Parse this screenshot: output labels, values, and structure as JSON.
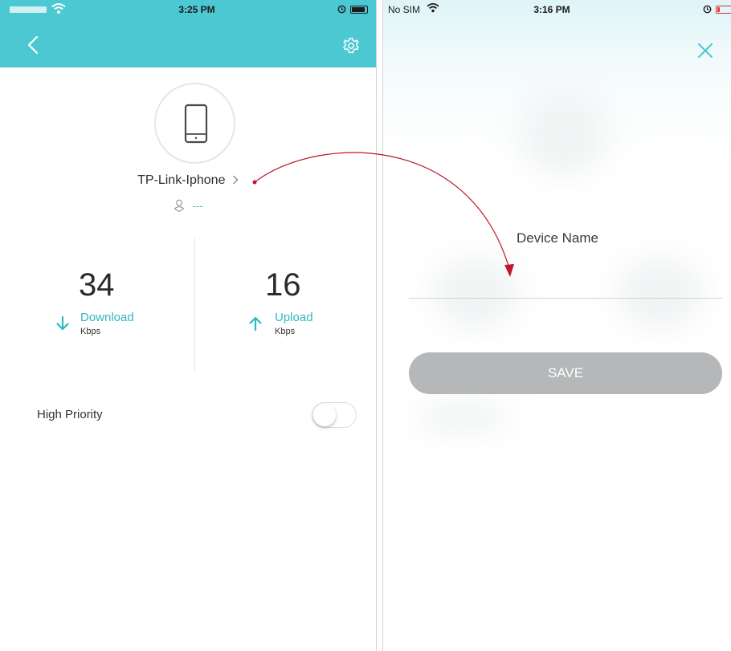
{
  "left_phone": {
    "status_bar": {
      "time": "3:25 PM"
    },
    "device": {
      "name": "TP-Link-Iphone",
      "user": "---"
    },
    "stats": {
      "download": {
        "value": "34",
        "label": "Download",
        "unit": "Kbps"
      },
      "upload": {
        "value": "16",
        "label": "Upload",
        "unit": "Kbps"
      }
    },
    "high_priority": {
      "label": "High Priority",
      "enabled": false
    }
  },
  "right_phone": {
    "status_bar": {
      "carrier": "No SIM",
      "time": "3:16 PM"
    },
    "form": {
      "title": "Device Name",
      "input_value": "",
      "save_label": "SAVE"
    }
  },
  "colors": {
    "accent": "#4cc8d2",
    "link": "#31b7c4",
    "save_button_disabled": "#b5b7b9",
    "annotation_arrow": "#c0152a"
  },
  "icons": [
    "wifi-icon",
    "back-icon",
    "gear-icon",
    "phone-icon",
    "chevron-right-icon",
    "user-icon",
    "arrow-down-icon",
    "arrow-up-icon",
    "close-icon",
    "lock-icon",
    "battery-icon"
  ]
}
